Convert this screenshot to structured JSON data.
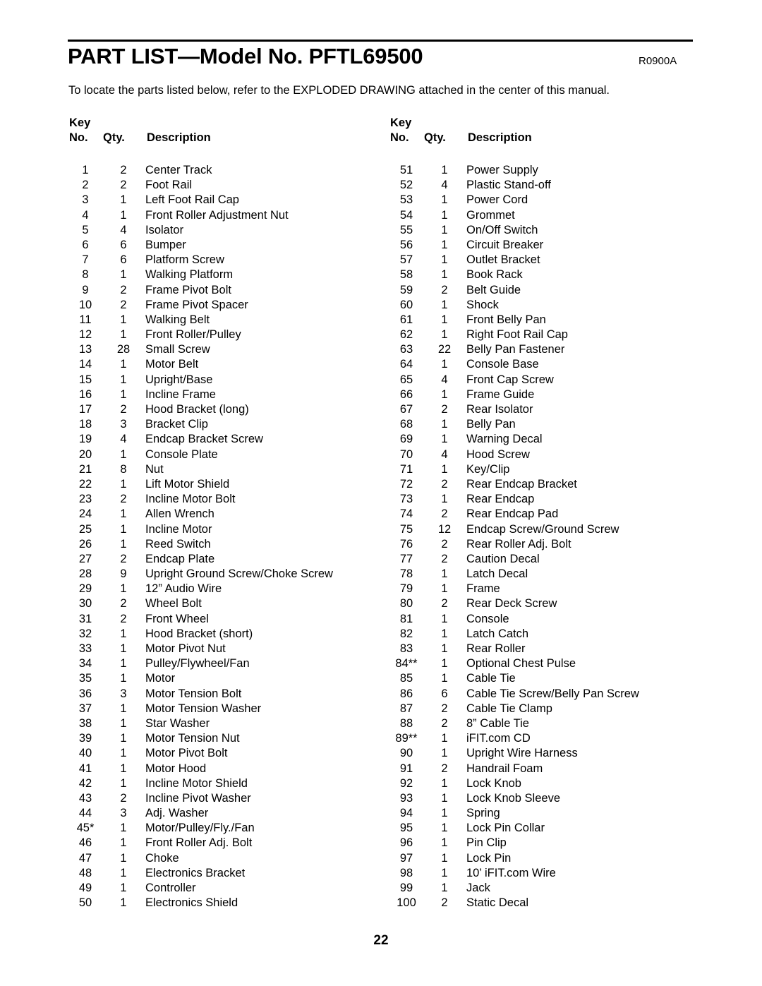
{
  "document": {
    "title": "PART LIST—Model No. PFTL69500",
    "revision_code": "R0900A",
    "intro": "To locate the parts listed below, refer to the EXPLODED DRAWING attached in the center of this manual.",
    "page_number": "22"
  },
  "table_headers": {
    "key_word": "Key",
    "no": "No.",
    "qty": "Qty.",
    "description": "Description"
  },
  "parts_left": [
    {
      "no": "1",
      "qty": "2",
      "desc": "Center Track"
    },
    {
      "no": "2",
      "qty": "2",
      "desc": "Foot Rail"
    },
    {
      "no": "3",
      "qty": "1",
      "desc": "Left Foot Rail Cap"
    },
    {
      "no": "4",
      "qty": "1",
      "desc": "Front Roller Adjustment Nut"
    },
    {
      "no": "5",
      "qty": "4",
      "desc": "Isolator"
    },
    {
      "no": "6",
      "qty": "6",
      "desc": "Bumper"
    },
    {
      "no": "7",
      "qty": "6",
      "desc": "Platform Screw"
    },
    {
      "no": "8",
      "qty": "1",
      "desc": "Walking Platform"
    },
    {
      "no": "9",
      "qty": "2",
      "desc": "Frame Pivot Bolt"
    },
    {
      "no": "10",
      "qty": "2",
      "desc": "Frame Pivot Spacer"
    },
    {
      "no": "11",
      "qty": "1",
      "desc": "Walking Belt"
    },
    {
      "no": "12",
      "qty": "1",
      "desc": "Front Roller/Pulley"
    },
    {
      "no": "13",
      "qty": "28",
      "desc": "Small Screw"
    },
    {
      "no": "14",
      "qty": "1",
      "desc": "Motor Belt"
    },
    {
      "no": "15",
      "qty": "1",
      "desc": "Upright/Base"
    },
    {
      "no": "16",
      "qty": "1",
      "desc": "Incline Frame"
    },
    {
      "no": "17",
      "qty": "2",
      "desc": "Hood Bracket (long)"
    },
    {
      "no": "18",
      "qty": "3",
      "desc": "Bracket Clip"
    },
    {
      "no": "19",
      "qty": "4",
      "desc": "Endcap Bracket Screw"
    },
    {
      "no": "20",
      "qty": "1",
      "desc": "Console Plate"
    },
    {
      "no": "21",
      "qty": "8",
      "desc": "Nut"
    },
    {
      "no": "22",
      "qty": "1",
      "desc": "Lift Motor Shield"
    },
    {
      "no": "23",
      "qty": "2",
      "desc": "Incline Motor Bolt"
    },
    {
      "no": "24",
      "qty": "1",
      "desc": "Allen Wrench"
    },
    {
      "no": "25",
      "qty": "1",
      "desc": "Incline Motor"
    },
    {
      "no": "26",
      "qty": "1",
      "desc": "Reed Switch"
    },
    {
      "no": "27",
      "qty": "2",
      "desc": "Endcap Plate"
    },
    {
      "no": "28",
      "qty": "9",
      "desc": "Upright Ground Screw/Choke Screw"
    },
    {
      "no": "29",
      "qty": "1",
      "desc": "12” Audio Wire"
    },
    {
      "no": "30",
      "qty": "2",
      "desc": "Wheel Bolt"
    },
    {
      "no": "31",
      "qty": "2",
      "desc": "Front Wheel"
    },
    {
      "no": "32",
      "qty": "1",
      "desc": "Hood Bracket (short)"
    },
    {
      "no": "33",
      "qty": "1",
      "desc": "Motor Pivot Nut"
    },
    {
      "no": "34",
      "qty": "1",
      "desc": "Pulley/Flywheel/Fan"
    },
    {
      "no": "35",
      "qty": "1",
      "desc": "Motor"
    },
    {
      "no": "36",
      "qty": "3",
      "desc": "Motor Tension Bolt"
    },
    {
      "no": "37",
      "qty": "1",
      "desc": "Motor Tension Washer"
    },
    {
      "no": "38",
      "qty": "1",
      "desc": "Star Washer"
    },
    {
      "no": "39",
      "qty": "1",
      "desc": "Motor Tension Nut"
    },
    {
      "no": "40",
      "qty": "1",
      "desc": "Motor Pivot Bolt"
    },
    {
      "no": "41",
      "qty": "1",
      "desc": "Motor Hood"
    },
    {
      "no": "42",
      "qty": "1",
      "desc": "Incline Motor Shield"
    },
    {
      "no": "43",
      "qty": "2",
      "desc": "Incline Pivot Washer"
    },
    {
      "no": "44",
      "qty": "3",
      "desc": "Adj. Washer"
    },
    {
      "no": "45*",
      "qty": "1",
      "desc": "Motor/Pulley/Fly./Fan"
    },
    {
      "no": "46",
      "qty": "1",
      "desc": "Front Roller Adj. Bolt"
    },
    {
      "no": "47",
      "qty": "1",
      "desc": "Choke"
    },
    {
      "no": "48",
      "qty": "1",
      "desc": "Electronics Bracket"
    },
    {
      "no": "49",
      "qty": "1",
      "desc": "Controller"
    },
    {
      "no": "50",
      "qty": "1",
      "desc": "Electronics Shield"
    }
  ],
  "parts_right": [
    {
      "no": "51",
      "qty": "1",
      "desc": "Power Supply"
    },
    {
      "no": "52",
      "qty": "4",
      "desc": "Plastic Stand-off"
    },
    {
      "no": "53",
      "qty": "1",
      "desc": "Power Cord"
    },
    {
      "no": "54",
      "qty": "1",
      "desc": "Grommet"
    },
    {
      "no": "55",
      "qty": "1",
      "desc": "On/Off Switch"
    },
    {
      "no": "56",
      "qty": "1",
      "desc": "Circuit Breaker"
    },
    {
      "no": "57",
      "qty": "1",
      "desc": "Outlet Bracket"
    },
    {
      "no": "58",
      "qty": "1",
      "desc": "Book Rack"
    },
    {
      "no": "59",
      "qty": "2",
      "desc": "Belt Guide"
    },
    {
      "no": "60",
      "qty": "1",
      "desc": "Shock"
    },
    {
      "no": "61",
      "qty": "1",
      "desc": "Front Belly Pan"
    },
    {
      "no": "62",
      "qty": "1",
      "desc": "Right Foot Rail Cap"
    },
    {
      "no": "63",
      "qty": "22",
      "desc": "Belly Pan Fastener"
    },
    {
      "no": "64",
      "qty": "1",
      "desc": "Console Base"
    },
    {
      "no": "65",
      "qty": "4",
      "desc": "Front Cap Screw"
    },
    {
      "no": "66",
      "qty": "1",
      "desc": "Frame Guide"
    },
    {
      "no": "67",
      "qty": "2",
      "desc": "Rear Isolator"
    },
    {
      "no": "68",
      "qty": "1",
      "desc": "Belly Pan"
    },
    {
      "no": "69",
      "qty": "1",
      "desc": "Warning Decal"
    },
    {
      "no": "70",
      "qty": "4",
      "desc": "Hood Screw"
    },
    {
      "no": "71",
      "qty": "1",
      "desc": "Key/Clip"
    },
    {
      "no": "72",
      "qty": "2",
      "desc": "Rear Endcap Bracket"
    },
    {
      "no": "73",
      "qty": "1",
      "desc": "Rear Endcap"
    },
    {
      "no": "74",
      "qty": "2",
      "desc": "Rear Endcap Pad"
    },
    {
      "no": "75",
      "qty": "12",
      "desc": "Endcap Screw/Ground Screw"
    },
    {
      "no": "76",
      "qty": "2",
      "desc": "Rear Roller Adj. Bolt"
    },
    {
      "no": "77",
      "qty": "2",
      "desc": "Caution Decal"
    },
    {
      "no": "78",
      "qty": "1",
      "desc": "Latch Decal"
    },
    {
      "no": "79",
      "qty": "1",
      "desc": "Frame"
    },
    {
      "no": "80",
      "qty": "2",
      "desc": "Rear Deck Screw"
    },
    {
      "no": "81",
      "qty": "1",
      "desc": "Console"
    },
    {
      "no": "82",
      "qty": "1",
      "desc": "Latch Catch"
    },
    {
      "no": "83",
      "qty": "1",
      "desc": "Rear Roller"
    },
    {
      "no": "84**",
      "qty": "1",
      "desc": "Optional Chest Pulse"
    },
    {
      "no": "85",
      "qty": "1",
      "desc": "Cable Tie"
    },
    {
      "no": "86",
      "qty": "6",
      "desc": "Cable Tie Screw/Belly Pan Screw"
    },
    {
      "no": "87",
      "qty": "2",
      "desc": "Cable Tie Clamp"
    },
    {
      "no": "88",
      "qty": "2",
      "desc": "8” Cable Tie"
    },
    {
      "no": "89**",
      "qty": "1",
      "desc": "iFIT.com CD"
    },
    {
      "no": "90",
      "qty": "1",
      "desc": "Upright Wire Harness"
    },
    {
      "no": "91",
      "qty": "2",
      "desc": "Handrail Foam"
    },
    {
      "no": "92",
      "qty": "1",
      "desc": "Lock Knob"
    },
    {
      "no": "93",
      "qty": "1",
      "desc": "Lock Knob Sleeve"
    },
    {
      "no": "94",
      "qty": "1",
      "desc": "Spring"
    },
    {
      "no": "95",
      "qty": "1",
      "desc": "Lock Pin Collar"
    },
    {
      "no": "96",
      "qty": "1",
      "desc": "Pin Clip"
    },
    {
      "no": "97",
      "qty": "1",
      "desc": "Lock Pin"
    },
    {
      "no": "98",
      "qty": "1",
      "desc": "10’ iFIT.com Wire"
    },
    {
      "no": "99",
      "qty": "1",
      "desc": "Jack"
    },
    {
      "no": "100",
      "qty": "2",
      "desc": "Static Decal"
    }
  ]
}
